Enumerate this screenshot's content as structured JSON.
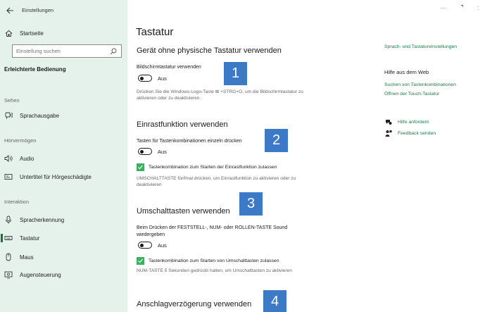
{
  "app": {
    "title": "Einstellungen"
  },
  "window_controls": {
    "minimize": "—",
    "maximize": "⌝",
    "extra": ":"
  },
  "sidebar": {
    "home": "Startseite",
    "search_placeholder": "Einstellung suchen",
    "section": "Erleichterte Bedienung",
    "groups": {
      "sehen": "Sehen",
      "hoeren": "Hörvermögen",
      "interaktion": "Interaktion"
    },
    "items": {
      "sprachausgabe": "Sprachausgabe",
      "audio": "Audio",
      "untertitel": "Untertitel für Hörgeschädigte",
      "spracherkennung": "Spracherkennung",
      "tastatur": "Tastatur",
      "maus": "Maus",
      "augensteuerung": "Augensteuerung"
    }
  },
  "main": {
    "title": "Tastatur",
    "s1": {
      "title": "Gerät ohne physische Tastatur verwenden",
      "setting": "Bildschirmtastatur verwenden",
      "state": "Aus",
      "desc": "Drücken Sie die Windows-Logo-Taste ⊞ +STRG+O, um die Bildschirmtastatur zu aktivieren oder zu deaktivieren."
    },
    "s2": {
      "title": "Einrastfunktion verwenden",
      "setting": "Tasten für Tastenkombinationen einzeln drücken",
      "state": "Aus",
      "checkbox": "Tastenkombination zum Starten der Einrastfunktion zulassen",
      "desc": "UMSCHALTTASTE fünfmal drücken, um Einrastfunktion zu aktivieren oder zu deaktivieren"
    },
    "s3": {
      "title": "Umschalttasten verwenden",
      "setting": "Beim Drücken der FESTSTELL-, NUM- oder ROLLEN-TASTE Sound wiedergeben",
      "state": "Aus",
      "checkbox": "Tastenkombination zum Starten von Umschalttasten zulassen",
      "desc": "NUM-TASTE 5 Sekunden gedrückt halten, um Umschalttasten zu aktivieren"
    },
    "s4": {
      "title": "Anschlagverzögerung verwenden"
    },
    "badges": [
      "1",
      "2",
      "3",
      "4"
    ]
  },
  "right": {
    "related_link": "Sprach- und Tastatureinstellungen",
    "help_heading": "Hilfe aus dem Web",
    "link1": "Suchen von Tastenkombinationen",
    "link2": "Öffnen der Touch-Tastatur",
    "help": "Hilfe anfordern",
    "feedback": "Feedback senden"
  },
  "colors": {
    "accent": "#1d7a45",
    "sidebar_bg": "#e5f1eb",
    "badge": "#3c79c6",
    "checkbox": "#3daf5f"
  }
}
